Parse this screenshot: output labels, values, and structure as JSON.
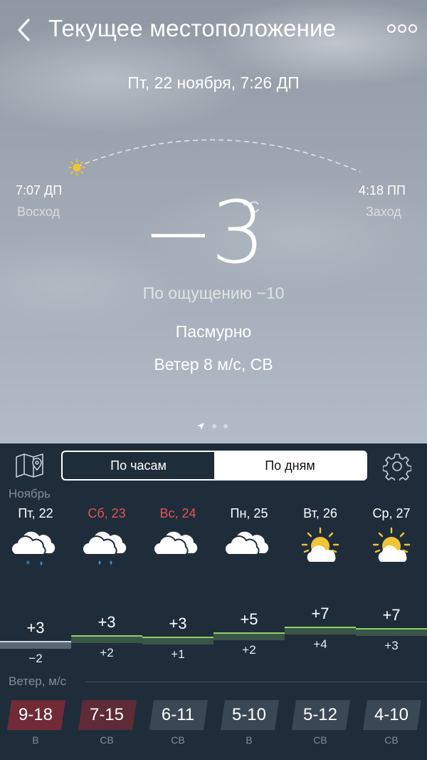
{
  "header": {
    "title": "Текущее местоположение",
    "back_icon": "chevron-left-icon",
    "more_icon": "more-dots-icon"
  },
  "now": {
    "datetime": "Пт, 22 ноября, 7:26 ДП",
    "sunrise_time": "7:07 ДП",
    "sunrise_label": "Восход",
    "sunset_time": "4:18 ПП",
    "sunset_label": "Заход",
    "temperature": "−3",
    "unit": "°C",
    "feels_like": "По ощущению −10",
    "condition": "Пасмурно",
    "wind": "Ветер 8 м/с, СВ"
  },
  "tabs": {
    "hourly": "По часам",
    "daily": "По дням",
    "active": "daily"
  },
  "month": "Ноябрь",
  "days": [
    {
      "label": "Пт, 22",
      "weekend": false,
      "icon": "cloud-snow-rain-icon",
      "high": "+3",
      "low": "−2"
    },
    {
      "label": "Сб, 23",
      "weekend": true,
      "icon": "cloud-rain-icon",
      "high": "+3",
      "low": "+2"
    },
    {
      "label": "Вс, 24",
      "weekend": true,
      "icon": "cloud-icon",
      "high": "+3",
      "low": "+1"
    },
    {
      "label": "Пн, 25",
      "weekend": false,
      "icon": "cloud-icon",
      "high": "+5",
      "low": "+2"
    },
    {
      "label": "Вт, 26",
      "weekend": false,
      "icon": "partly-sunny-icon",
      "high": "+7",
      "low": "+4"
    },
    {
      "label": "Ср, 27",
      "weekend": false,
      "icon": "partly-sunny-icon",
      "high": "+7",
      "low": "+3"
    }
  ],
  "wind_header": "Ветер, м/с",
  "wind": [
    {
      "range": "9-18",
      "dir": "В",
      "strong": true
    },
    {
      "range": "7-15",
      "dir": "СВ",
      "strong": true
    },
    {
      "range": "6-11",
      "dir": "СВ",
      "strong": false
    },
    {
      "range": "5-10",
      "dir": "В",
      "strong": false
    },
    {
      "range": "5-12",
      "dir": "СВ",
      "strong": false
    },
    {
      "range": "4-10",
      "dir": "СВ",
      "strong": false
    }
  ],
  "colors": {
    "panel": "#1f2d3b",
    "weekend": "#e2544d",
    "warm_line": "#8fd16a",
    "cold_line": "#c9d6e3",
    "strong_wind": "#8a2f3a"
  }
}
